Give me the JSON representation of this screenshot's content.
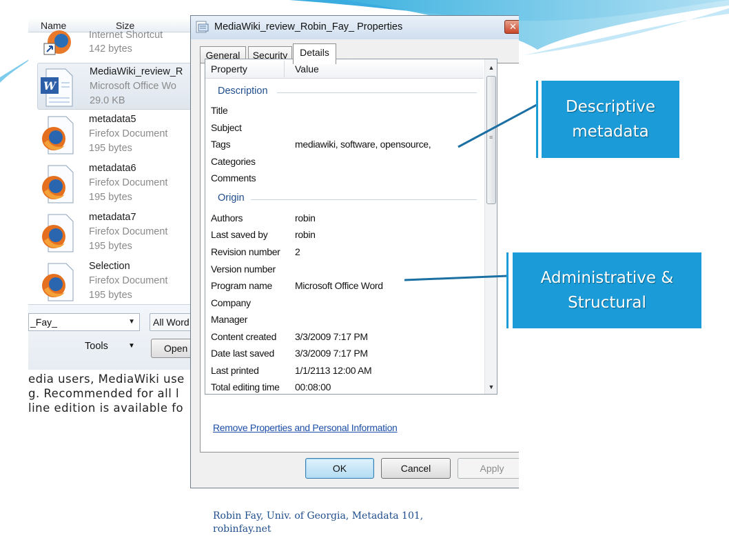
{
  "explorer": {
    "columns": [
      "Name",
      "Size"
    ],
    "files": [
      {
        "name": "Internet Shortcut",
        "type": "",
        "size": "142 bytes",
        "icon": "firefox-shortcut-icon"
      },
      {
        "name": "MediaWiki_review_R",
        "type": "Microsoft Office Wo",
        "size": "29.0 KB",
        "icon": "word-document-icon"
      },
      {
        "name": "metadata5",
        "type": "Firefox Document",
        "size": "195 bytes",
        "icon": "firefox-document-icon"
      },
      {
        "name": "metadata6",
        "type": "Firefox Document",
        "size": "195 bytes",
        "icon": "firefox-document-icon"
      },
      {
        "name": "metadata7",
        "type": "Firefox Document",
        "size": "195 bytes",
        "icon": "firefox-document-icon"
      },
      {
        "name": "Selection",
        "type": "Firefox Document",
        "size": "195 bytes",
        "icon": "firefox-document-icon"
      }
    ],
    "filename_value": "_Fay_",
    "filetype_value": "All Word",
    "tools_label": "Tools",
    "open_label": "Open",
    "web_text": [
      "edia users, MediaWiki use",
      "g. Recommended for all l",
      "line edition is available fo"
    ]
  },
  "dialog": {
    "title": "MediaWiki_review_Robin_Fay_ Properties",
    "tabs": [
      "General",
      "Security",
      "Details"
    ],
    "active_tab": "Details",
    "list_headers": {
      "property": "Property",
      "value": "Value"
    },
    "groups": {
      "description": "Description",
      "origin": "Origin"
    },
    "description_rows": [
      {
        "name": "Title",
        "value": ""
      },
      {
        "name": "Subject",
        "value": ""
      },
      {
        "name": "Tags",
        "value": "mediawiki, software, opensource,"
      },
      {
        "name": "Categories",
        "value": ""
      },
      {
        "name": "Comments",
        "value": ""
      }
    ],
    "origin_rows": [
      {
        "name": "Authors",
        "value": "robin"
      },
      {
        "name": "Last saved by",
        "value": "robin"
      },
      {
        "name": "Revision number",
        "value": "2"
      },
      {
        "name": "Version number",
        "value": ""
      },
      {
        "name": "Program name",
        "value": "Microsoft Office Word"
      },
      {
        "name": "Company",
        "value": ""
      },
      {
        "name": "Manager",
        "value": ""
      },
      {
        "name": "Content created",
        "value": "3/3/2009 7:17 PM"
      },
      {
        "name": "Date last saved",
        "value": "3/3/2009 7:17 PM"
      },
      {
        "name": "Last printed",
        "value": "1/1/2113 12:00 AM"
      },
      {
        "name": "Total editing time",
        "value": "00:08:00"
      }
    ],
    "remove_link": "Remove Properties and Personal Information",
    "buttons": {
      "ok": "OK",
      "cancel": "Cancel",
      "apply": "Apply"
    }
  },
  "callouts": {
    "descriptive": [
      "Descriptive",
      "metadata"
    ],
    "administrative": [
      "Administrative &",
      "Structural"
    ]
  },
  "footer": [
    "Robin Fay, Univ. of Georgia, Metadata 101,",
    "robinfay.net"
  ],
  "colors": {
    "callout": "#1b9bd7",
    "link": "#1c4ea8",
    "group_header": "#1f4d8c",
    "connector": "#1a6fa3"
  }
}
